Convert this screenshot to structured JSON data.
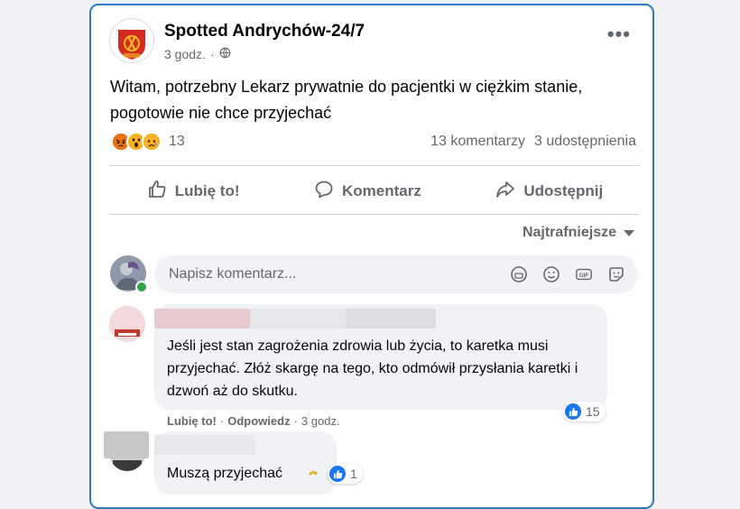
{
  "post": {
    "page_name": "Spotted Andrychów-24/7",
    "time": "3 godz.",
    "separator": "·",
    "text": "Witam, potrzebny Lekarz prywatnie do pacjentki w ciężkim stanie, pogotowie nie chce przyjechać",
    "reaction_count": "13",
    "comments_count": "13 komentarzy",
    "shares_count": "3 udostępnienia",
    "reaction_icons": [
      "angry-reaction",
      "wow-reaction",
      "sad-reaction"
    ]
  },
  "actions": {
    "like": "Lubię to!",
    "comment": "Komentarz",
    "share": "Udostępnij"
  },
  "sort": {
    "label": "Najtrafniejsze"
  },
  "composer": {
    "placeholder": "Napisz komentarz..."
  },
  "comments": [
    {
      "text": "Jeśli jest stan zagrożenia zdrowia lub życia, to karetka musi przyjechać. Złóż skargę na tego, kto odmówił przysłania karetki i dzwoń aż do skutku.",
      "like_label": "Lubię to!",
      "reply_label": "Odpowiedz",
      "time": "3 godz.",
      "likes": "15"
    },
    {
      "text": "Muszą przyjechać",
      "likes": "1"
    }
  ],
  "colors": {
    "accent": "#1877f2",
    "border_highlight": "#2f7bbf",
    "secondary_text": "#65676b"
  }
}
